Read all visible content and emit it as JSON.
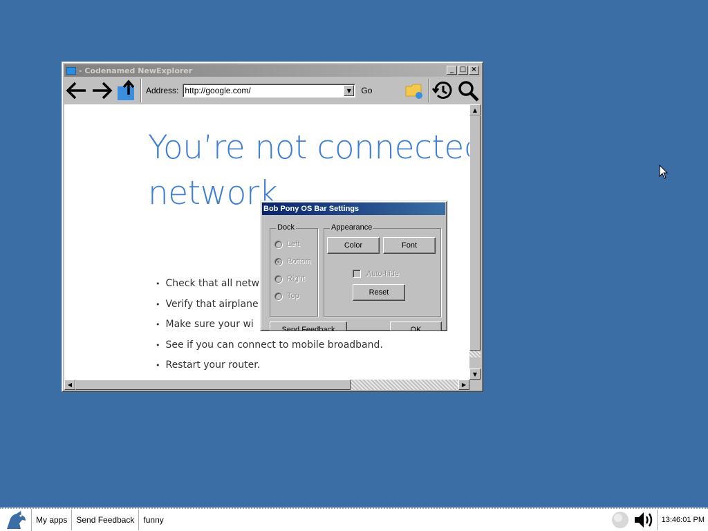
{
  "window": {
    "title": "- Codenamed NewExplorer",
    "address_label": "Address:",
    "address_value": "http://google.com/",
    "go_label": "Go",
    "min_glyph": "_",
    "max_glyph": "□",
    "close_glyph": "×"
  },
  "page": {
    "heading_line1": "You’re not connected",
    "heading_line2": "network",
    "suggestions": [
      "Check that all netw",
      "Verify that airplane",
      "Make sure your wi",
      "See if you can connect to mobile broadband.",
      "Restart your router."
    ]
  },
  "dialog": {
    "title": "Bob Pony OS Bar Settings",
    "dock_label": "Dock",
    "dock_options": [
      "Left",
      "Bottom",
      "Right",
      "Top"
    ],
    "dock_selected": "Bottom",
    "appearance_label": "Appearance",
    "color_button": "Color",
    "font_button": "Font",
    "autohide_label": "Auto-hide",
    "autohide_checked": false,
    "reset_button": "Reset",
    "feedback_button": "Send Feedback",
    "ok_button": "OK"
  },
  "taskbar": {
    "items": [
      "My apps",
      "Send Feedback",
      "funny"
    ],
    "clock": "13:46:01 PM"
  },
  "icons": {
    "back": "arrow-left-icon",
    "forward": "arrow-right-icon",
    "up": "up-folder-icon",
    "folder": "folder-icon",
    "history": "history-icon",
    "search": "magnifier-icon"
  },
  "colors": {
    "desktop": "#3a6ea5",
    "heading_text": "#3f7fd4",
    "dialog_title": "#0a246a"
  }
}
